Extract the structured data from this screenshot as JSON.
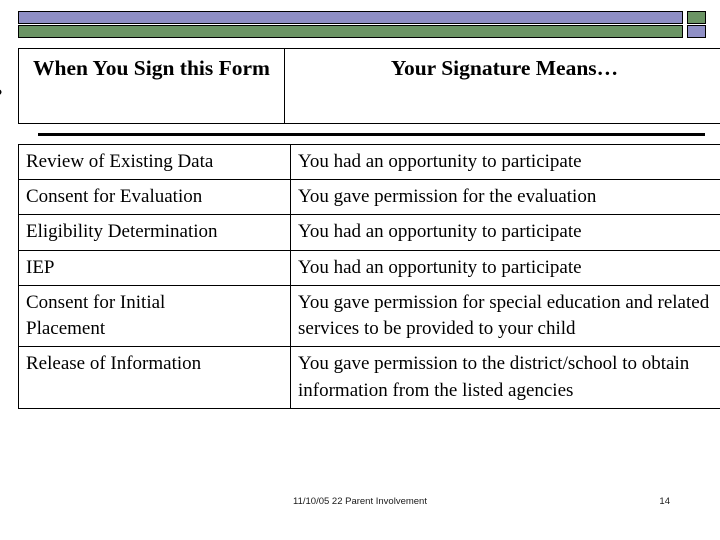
{
  "decoration": {
    "bar_top_color": "#8f8fc5",
    "bar_bottom_color": "#6b9464",
    "cap_top_color": "#6b9464",
    "cap_bottom_color": "#8f8fc5",
    "outline_color": "#000000"
  },
  "edge_glyph": {
    "text": "•"
  },
  "table": {
    "headers": [
      "When You Sign this Form",
      "Your Signature Means…"
    ],
    "rows": [
      {
        "form": "Review of Existing Data",
        "meaning": "You had an opportunity to participate"
      },
      {
        "form": "Consent for Evaluation",
        "meaning": "You gave permission for the evaluation"
      },
      {
        "form": "Eligibility Determination",
        "meaning": "You had an opportunity to participate"
      },
      {
        "form": "IEP",
        "meaning": "You had an opportunity to participate"
      },
      {
        "form": "Consent for Initial\nPlacement",
        "meaning": "You gave permission for special education and related services to be provided to your child"
      },
      {
        "form": "Release of Information",
        "meaning": "You gave permission to the district/school to obtain information from the listed agencies"
      }
    ]
  },
  "footer": {
    "note": "11/10/05 22 Parent Involvement",
    "page_number": "14"
  }
}
